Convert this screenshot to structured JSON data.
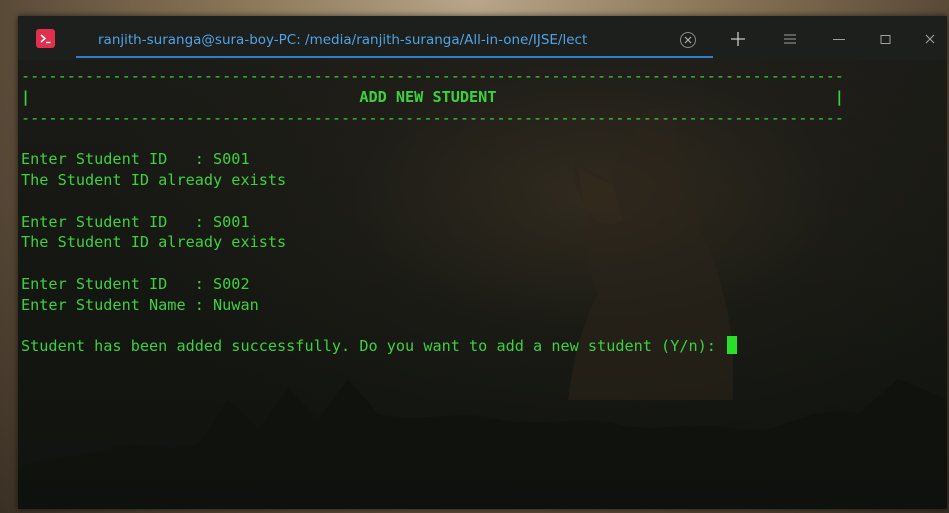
{
  "window": {
    "tab_title": "ranjith-suranga@sura-boy-PC: /media/ranjith-suranga/All-in-one/IJSE/lect",
    "app_icon": "terminal-icon",
    "controls": [
      "new-tab-icon",
      "menu-icon",
      "minimize-icon",
      "maximize-icon",
      "close-icon"
    ]
  },
  "terminal": {
    "lines": [
      {
        "text": "------------------------------------------------------------------------------------------",
        "bold": false
      },
      {
        "text": "|                                    ADD NEW STUDENT                                     |",
        "bold": true
      },
      {
        "text": "------------------------------------------------------------------------------------------",
        "bold": false
      },
      {
        "text": "",
        "bold": false
      },
      {
        "text": "Enter Student ID   : S001",
        "bold": false
      },
      {
        "text": "The Student ID already exists",
        "bold": false
      },
      {
        "text": "",
        "bold": false
      },
      {
        "text": "Enter Student ID   : S001",
        "bold": false
      },
      {
        "text": "The Student ID already exists",
        "bold": false
      },
      {
        "text": "",
        "bold": false
      },
      {
        "text": "Enter Student ID   : S002",
        "bold": false
      },
      {
        "text": "Enter Student Name : Nuwan",
        "bold": false
      },
      {
        "text": "",
        "bold": false
      },
      {
        "text": "Student has been added successfully. Do you want to add a new student (Y/n): ",
        "bold": false
      }
    ],
    "text_color": "#3dd13d",
    "cursor_color": "#29e029"
  },
  "colors": {
    "tab_accent": "#2f7fc8",
    "app_icon_bg": "#e0304e"
  }
}
